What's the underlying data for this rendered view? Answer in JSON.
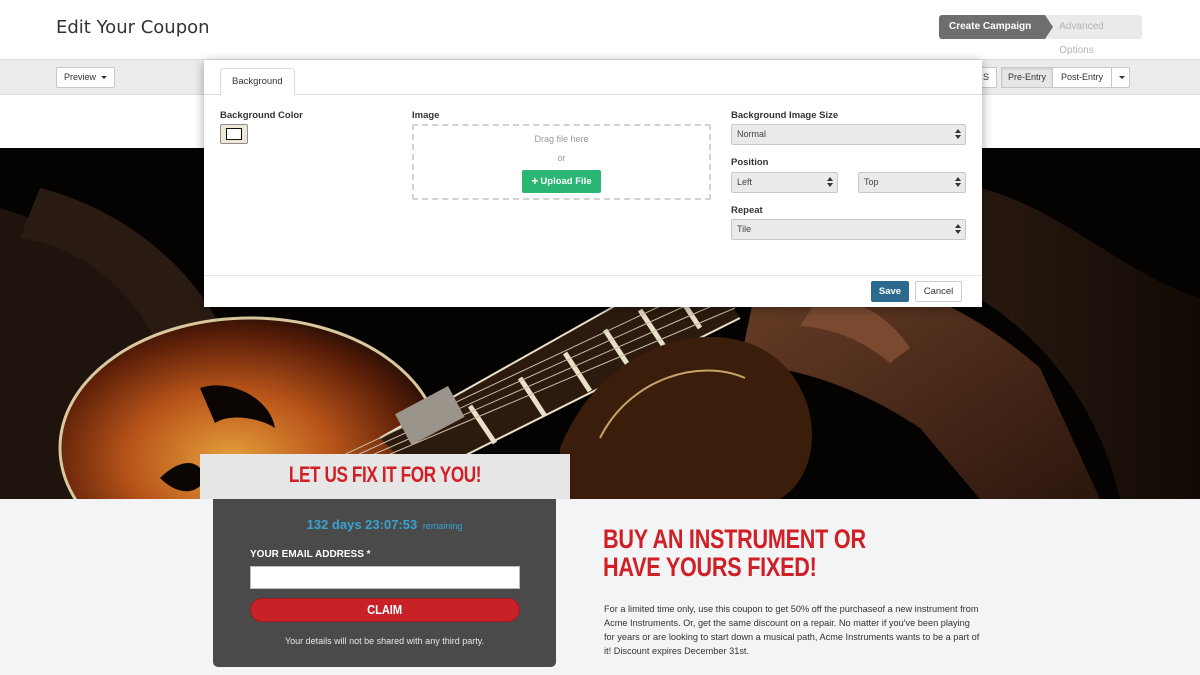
{
  "header": {
    "title": "Edit Your Coupon",
    "steps": [
      "Create Campaign",
      "Advanced Options"
    ]
  },
  "toolbar": {
    "preview_label": "Preview",
    "partial_label": "S",
    "pre_entry_label": "Pre-Entry",
    "post_entry_label": "Post-Entry"
  },
  "modal": {
    "tab_label": "Background",
    "background_color_label": "Background Color",
    "image_label": "Image",
    "drag_text": "Drag file here",
    "or_text": "or",
    "upload_label": "Upload File",
    "image_size_label": "Background Image Size",
    "image_size_value": "Normal",
    "position_label": "Position",
    "position_x_value": "Left",
    "position_y_value": "Top",
    "repeat_label": "Repeat",
    "repeat_value": "Tile",
    "save_label": "Save",
    "cancel_label": "Cancel"
  },
  "coupon": {
    "title": "LET US FIX IT FOR YOU!",
    "countdown": "132 days 23:07:53",
    "countdown_suffix": "remaining",
    "email_label": "YOUR EMAIL ADDRESS *",
    "claim_label": "CLAIM",
    "privacy_text": "Your details will not be shared with any third party."
  },
  "promo": {
    "title": "BUY AN INSTRUMENT OR HAVE YOURS FIXED!",
    "body": "For a limited time only, use this coupon to get 50% off the purchaseof a new instrument from Acme Instruments. Or, get the same discount on a repair. No matter if you've been playing for years or are looking to start down a musical path, Acme Instruments wants to be a part of it! Discount expires December 31st."
  },
  "colors": {
    "accent_red": "#d11f26",
    "upload_green": "#2bb673",
    "save_blue": "#2b6a8e",
    "countdown_blue": "#38a3d0"
  },
  "icons": [
    "plus-icon",
    "caret-down-icon"
  ]
}
